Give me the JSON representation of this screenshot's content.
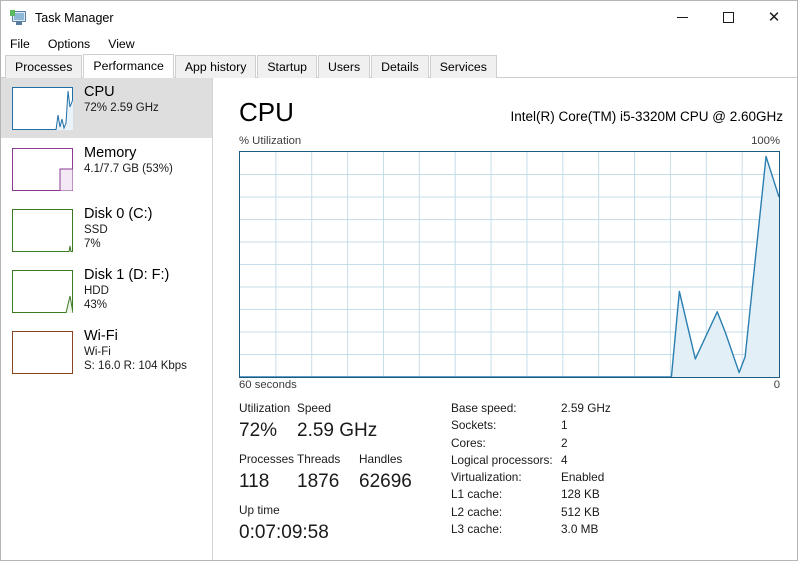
{
  "window": {
    "title": "Task Manager",
    "icon": "task-manager-monitor-icon",
    "minimize": "–",
    "maximize": "□",
    "close": "✕"
  },
  "menu": {
    "items": [
      {
        "label": "File"
      },
      {
        "label": "Options"
      },
      {
        "label": "View"
      }
    ]
  },
  "tabs": {
    "active": "Performance",
    "items": [
      {
        "label": "Processes"
      },
      {
        "label": "Performance"
      },
      {
        "label": "App history"
      },
      {
        "label": "Startup"
      },
      {
        "label": "Users"
      },
      {
        "label": "Details"
      },
      {
        "label": "Services"
      }
    ]
  },
  "sidebar": {
    "items": [
      {
        "title": "CPU",
        "sub1": "72%  2.59 GHz",
        "sub2": "",
        "selected": true,
        "color": "#1f6fa8",
        "fill": "#eaf3fa"
      },
      {
        "title": "Memory",
        "sub1": "4.1/7.7 GB (53%)",
        "sub2": "",
        "selected": false,
        "color": "#8b3a94",
        "fill": "#f3e9f5"
      },
      {
        "title": "Disk 0 (C:)",
        "sub1": "SSD",
        "sub2": "7%",
        "selected": false,
        "color": "#3d7a24",
        "fill": "#eef5e9"
      },
      {
        "title": "Disk 1 (D: F:)",
        "sub1": "HDD",
        "sub2": "43%",
        "selected": false,
        "color": "#3d7a24",
        "fill": "#eef5e9"
      },
      {
        "title": "Wi-Fi",
        "sub1": "Wi-Fi",
        "sub2": "S: 16.0 R: 104 Kbps",
        "selected": false,
        "color": "#8a4420",
        "fill": "#f7eee8"
      }
    ]
  },
  "main": {
    "heading": "CPU",
    "model": "Intel(R) Core(TM) i5-3320M CPU @ 2.60GHz",
    "axis_top_left": "% Utilization",
    "axis_top_right": "100%",
    "axis_bottom_left": "60 seconds",
    "axis_bottom_right": "0",
    "graph_line_color": "#2a7fb0",
    "graph_fill_color": "#e3eff7",
    "graph_border_color": "#1b5b84",
    "graph_grid_color": "#c5dcea",
    "stats": {
      "utilization_label": "Utilization",
      "utilization_value": "72%",
      "speed_label": "Speed",
      "speed_value": "2.59 GHz",
      "processes_label": "Processes",
      "processes_value": "118",
      "threads_label": "Threads",
      "threads_value": "1876",
      "handles_label": "Handles",
      "handles_value": "62696",
      "uptime_label": "Up time",
      "uptime_value": "0:07:09:58"
    },
    "specs": [
      {
        "label": "Base speed:",
        "value": "2.59 GHz"
      },
      {
        "label": "Sockets:",
        "value": "1"
      },
      {
        "label": "Cores:",
        "value": "2"
      },
      {
        "label": "Logical processors:",
        "value": "4"
      },
      {
        "label": "Virtualization:",
        "value": "Enabled"
      },
      {
        "label": "L1 cache:",
        "value": "128 KB"
      },
      {
        "label": "L2 cache:",
        "value": "512 KB"
      },
      {
        "label": "L3 cache:",
        "value": "3.0 MB"
      }
    ]
  },
  "chart_data": {
    "type": "area",
    "title": "CPU % Utilization",
    "xlabel": "60 seconds",
    "ylabel": "% Utilization",
    "xlim": [
      0,
      60
    ],
    "ylim": [
      0,
      100
    ],
    "grid": true,
    "grid_columns": 15,
    "grid_rows": 10,
    "legend": "none",
    "series": [
      {
        "name": "CPU Utilization",
        "x": [
          0,
          48.0,
          48.9,
          50.7,
          53.1,
          54.0,
          55.6,
          56.3,
          57.9,
          60.0
        ],
        "values": [
          0,
          0,
          38,
          8,
          29,
          20,
          2,
          9,
          98,
          72
        ]
      }
    ]
  }
}
